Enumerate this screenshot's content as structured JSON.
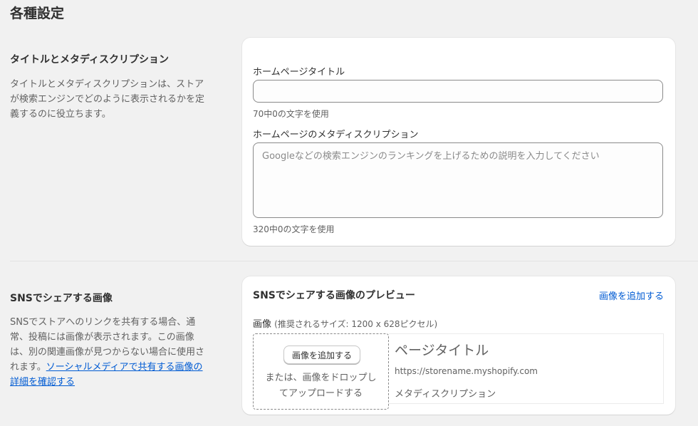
{
  "page": {
    "title": "各種設定"
  },
  "meta_section": {
    "heading": "タイトルとメタディスクリプション",
    "description": "タイトルとメタディスクリプションは、ストアが検索エンジンでどのように表示されるかを定義するのに役立ちます。",
    "title_field": {
      "label": "ホームページタイトル",
      "value": "",
      "help": "70中0の文字を使用"
    },
    "description_field": {
      "label": "ホームページのメタディスクリプション",
      "value": "",
      "placeholder": "Googleなどの検索エンジンのランキングを上げるための説明を入力してください",
      "help": "320中0の文字を使用"
    }
  },
  "sns_section": {
    "heading": "SNSでシェアする画像",
    "description": "SNSでストアへのリンクを共有する場合、通常、投稿には画像が表示されます。この画像は、別の関連画像が見つからない場合に使用されます。",
    "description_link": "ソーシャルメディアで共有する画像の詳細を確認する",
    "card_title": "SNSでシェアする画像のプレビュー",
    "add_image_link": "画像を追加する",
    "image_label": "画像",
    "image_size_hint": "(推奨されるサイズ: 1200 x 628ピクセル)",
    "dropzone": {
      "button_label": "画像を追加する",
      "hint": "または、画像をドロップしてアップロードする"
    },
    "preview": {
      "title": "ページタイトル",
      "url": "https://storename.myshopify.com",
      "description": "メタディスクリプション"
    }
  },
  "colors": {
    "background": "#f1f1f1",
    "card": "#ffffff",
    "link": "#005bd3",
    "text": "#303030",
    "muted_text": "#616161"
  }
}
